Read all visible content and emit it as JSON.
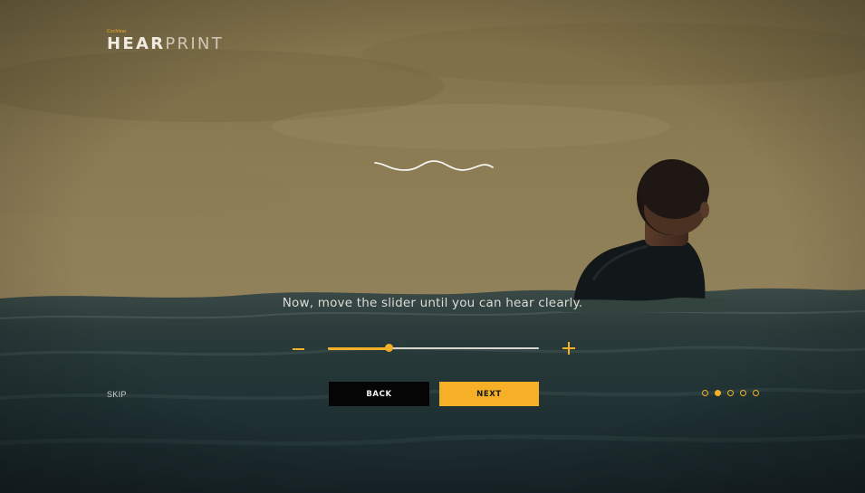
{
  "brand": {
    "super_label": "Cochlear",
    "word_bold": "HEAR",
    "word_light": "PRINT"
  },
  "instruction": "Now, move the slider until you can hear clearly.",
  "slider": {
    "value": 0.29,
    "decrease_icon": "minus-icon",
    "increase_icon": "plus-icon"
  },
  "actions": {
    "skip": "SKIP",
    "back": "BACK",
    "next": "NEXT"
  },
  "pagination": {
    "total": 5,
    "current": 2
  },
  "colors": {
    "accent": "#f5b027",
    "back_button": "#050505",
    "text_light": "#dcdcd6"
  }
}
